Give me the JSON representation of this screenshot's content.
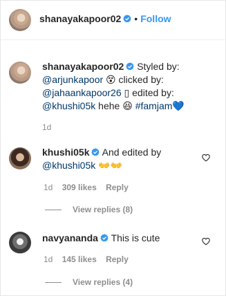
{
  "header": {
    "username": "shanayakapoor02",
    "separator": "•",
    "follow_label": "Follow"
  },
  "caption": {
    "username": "shanayakapoor02",
    "line1": "Styled by:",
    "mention1": "@arjunkapoor",
    "emoji1": "😵",
    "clicked": "clicked by:",
    "mention2": "@jahaankapoor26",
    "box": "▯",
    "edited": "edited by:",
    "mention3": "@khushi05k",
    "hehe": "hehe",
    "emoji2": "😆",
    "hashtag": "#famjam",
    "heart": "💙",
    "time": "1d"
  },
  "comments": [
    {
      "username": "khushi05k",
      "text": "And edited by",
      "mention": "@khushi05k",
      "emoji": "👐👐",
      "time": "1d",
      "likes": "309 likes",
      "reply": "Reply",
      "view_replies": "View replies (8)"
    },
    {
      "username": "navyananda",
      "text": "This is cute",
      "time": "1d",
      "likes": "145 likes",
      "reply": "Reply",
      "view_replies": "View replies (4)"
    }
  ],
  "colors": {
    "link": "#00376b",
    "follow": "#3897f0",
    "muted": "#8e8e8e",
    "verified": "#3897f0"
  }
}
